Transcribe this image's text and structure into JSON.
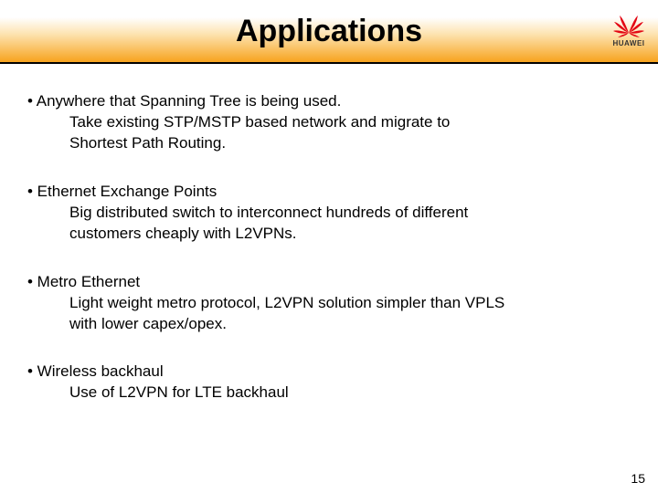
{
  "title": "Applications",
  "logo_text": "HUAWEI",
  "bullets": [
    {
      "head": "• Anywhere that Spanning Tree is being used.",
      "sub1": "Take existing STP/MSTP based network and migrate to",
      "sub2": "Shortest Path Routing."
    },
    {
      "head": "• Ethernet Exchange Points",
      "sub1": "Big distributed switch to interconnect hundreds of different",
      "sub2": "customers cheaply with L2VPNs."
    },
    {
      "head": "• Metro Ethernet",
      "sub1": "Light weight metro protocol, L2VPN solution simpler than VPLS",
      "sub2": "with lower capex/opex."
    },
    {
      "head": "• Wireless backhaul",
      "sub1": "Use of L2VPN for LTE backhaul",
      "sub2": ""
    }
  ],
  "page_number": "15"
}
